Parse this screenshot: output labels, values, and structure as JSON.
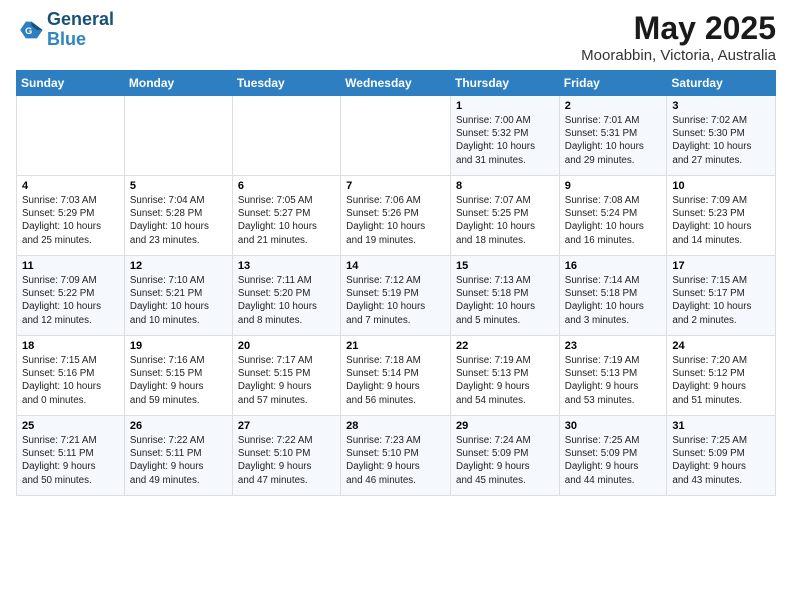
{
  "header": {
    "logo_line1": "General",
    "logo_line2": "Blue",
    "month": "May 2025",
    "location": "Moorabbin, Victoria, Australia"
  },
  "weekdays": [
    "Sunday",
    "Monday",
    "Tuesday",
    "Wednesday",
    "Thursday",
    "Friday",
    "Saturday"
  ],
  "weeks": [
    [
      {
        "day": "",
        "info": ""
      },
      {
        "day": "",
        "info": ""
      },
      {
        "day": "",
        "info": ""
      },
      {
        "day": "",
        "info": ""
      },
      {
        "day": "1",
        "info": "Sunrise: 7:00 AM\nSunset: 5:32 PM\nDaylight: 10 hours\nand 31 minutes."
      },
      {
        "day": "2",
        "info": "Sunrise: 7:01 AM\nSunset: 5:31 PM\nDaylight: 10 hours\nand 29 minutes."
      },
      {
        "day": "3",
        "info": "Sunrise: 7:02 AM\nSunset: 5:30 PM\nDaylight: 10 hours\nand 27 minutes."
      }
    ],
    [
      {
        "day": "4",
        "info": "Sunrise: 7:03 AM\nSunset: 5:29 PM\nDaylight: 10 hours\nand 25 minutes."
      },
      {
        "day": "5",
        "info": "Sunrise: 7:04 AM\nSunset: 5:28 PM\nDaylight: 10 hours\nand 23 minutes."
      },
      {
        "day": "6",
        "info": "Sunrise: 7:05 AM\nSunset: 5:27 PM\nDaylight: 10 hours\nand 21 minutes."
      },
      {
        "day": "7",
        "info": "Sunrise: 7:06 AM\nSunset: 5:26 PM\nDaylight: 10 hours\nand 19 minutes."
      },
      {
        "day": "8",
        "info": "Sunrise: 7:07 AM\nSunset: 5:25 PM\nDaylight: 10 hours\nand 18 minutes."
      },
      {
        "day": "9",
        "info": "Sunrise: 7:08 AM\nSunset: 5:24 PM\nDaylight: 10 hours\nand 16 minutes."
      },
      {
        "day": "10",
        "info": "Sunrise: 7:09 AM\nSunset: 5:23 PM\nDaylight: 10 hours\nand 14 minutes."
      }
    ],
    [
      {
        "day": "11",
        "info": "Sunrise: 7:09 AM\nSunset: 5:22 PM\nDaylight: 10 hours\nand 12 minutes."
      },
      {
        "day": "12",
        "info": "Sunrise: 7:10 AM\nSunset: 5:21 PM\nDaylight: 10 hours\nand 10 minutes."
      },
      {
        "day": "13",
        "info": "Sunrise: 7:11 AM\nSunset: 5:20 PM\nDaylight: 10 hours\nand 8 minutes."
      },
      {
        "day": "14",
        "info": "Sunrise: 7:12 AM\nSunset: 5:19 PM\nDaylight: 10 hours\nand 7 minutes."
      },
      {
        "day": "15",
        "info": "Sunrise: 7:13 AM\nSunset: 5:18 PM\nDaylight: 10 hours\nand 5 minutes."
      },
      {
        "day": "16",
        "info": "Sunrise: 7:14 AM\nSunset: 5:18 PM\nDaylight: 10 hours\nand 3 minutes."
      },
      {
        "day": "17",
        "info": "Sunrise: 7:15 AM\nSunset: 5:17 PM\nDaylight: 10 hours\nand 2 minutes."
      }
    ],
    [
      {
        "day": "18",
        "info": "Sunrise: 7:15 AM\nSunset: 5:16 PM\nDaylight: 10 hours\nand 0 minutes."
      },
      {
        "day": "19",
        "info": "Sunrise: 7:16 AM\nSunset: 5:15 PM\nDaylight: 9 hours\nand 59 minutes."
      },
      {
        "day": "20",
        "info": "Sunrise: 7:17 AM\nSunset: 5:15 PM\nDaylight: 9 hours\nand 57 minutes."
      },
      {
        "day": "21",
        "info": "Sunrise: 7:18 AM\nSunset: 5:14 PM\nDaylight: 9 hours\nand 56 minutes."
      },
      {
        "day": "22",
        "info": "Sunrise: 7:19 AM\nSunset: 5:13 PM\nDaylight: 9 hours\nand 54 minutes."
      },
      {
        "day": "23",
        "info": "Sunrise: 7:19 AM\nSunset: 5:13 PM\nDaylight: 9 hours\nand 53 minutes."
      },
      {
        "day": "24",
        "info": "Sunrise: 7:20 AM\nSunset: 5:12 PM\nDaylight: 9 hours\nand 51 minutes."
      }
    ],
    [
      {
        "day": "25",
        "info": "Sunrise: 7:21 AM\nSunset: 5:11 PM\nDaylight: 9 hours\nand 50 minutes."
      },
      {
        "day": "26",
        "info": "Sunrise: 7:22 AM\nSunset: 5:11 PM\nDaylight: 9 hours\nand 49 minutes."
      },
      {
        "day": "27",
        "info": "Sunrise: 7:22 AM\nSunset: 5:10 PM\nDaylight: 9 hours\nand 47 minutes."
      },
      {
        "day": "28",
        "info": "Sunrise: 7:23 AM\nSunset: 5:10 PM\nDaylight: 9 hours\nand 46 minutes."
      },
      {
        "day": "29",
        "info": "Sunrise: 7:24 AM\nSunset: 5:09 PM\nDaylight: 9 hours\nand 45 minutes."
      },
      {
        "day": "30",
        "info": "Sunrise: 7:25 AM\nSunset: 5:09 PM\nDaylight: 9 hours\nand 44 minutes."
      },
      {
        "day": "31",
        "info": "Sunrise: 7:25 AM\nSunset: 5:09 PM\nDaylight: 9 hours\nand 43 minutes."
      }
    ]
  ]
}
